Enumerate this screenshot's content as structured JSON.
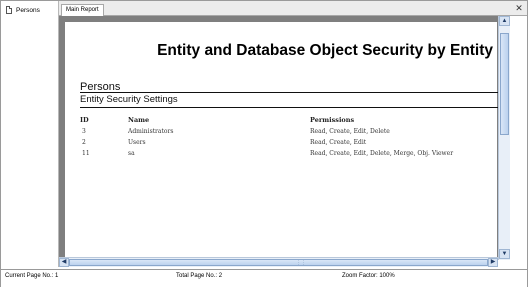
{
  "navigator": {
    "item": "Persons"
  },
  "tabs": [
    {
      "label": "Main Report"
    }
  ],
  "report": {
    "title": "Entity and Database Object Security by Entity",
    "section": "Persons",
    "subheading": "Entity Security Settings",
    "columns": [
      "ID",
      "Name",
      "Permissions"
    ],
    "rows": [
      {
        "id": "3",
        "name": "Administrators",
        "permissions": "Read, Create, Edit, Delete"
      },
      {
        "id": "2",
        "name": "Users",
        "permissions": "Read, Create, Edit"
      },
      {
        "id": "11",
        "name": "sa",
        "permissions": "Read, Create, Edit, Delete, Merge, Obj. Viewer"
      }
    ]
  },
  "status": {
    "current_page": "Current Page No.: 1",
    "total_page": "Total Page No.: 2",
    "zoom": "Zoom Factor: 100%"
  },
  "icons": {
    "close": "close-icon",
    "document": "document-icon",
    "scroll_up": "arrow-up-icon",
    "scroll_down": "arrow-down-icon",
    "scroll_left": "arrow-left-icon",
    "scroll_right": "arrow-right-icon"
  }
}
